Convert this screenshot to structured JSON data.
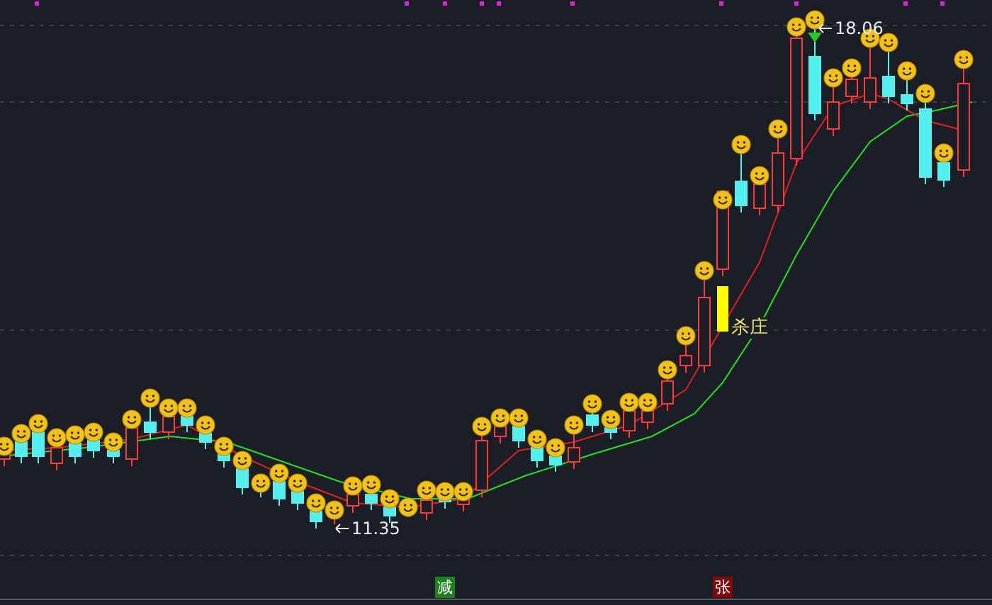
{
  "price_labels": [
    {
      "kind": "high",
      "text": "18.06"
    },
    {
      "kind": "low",
      "text": "11.35"
    }
  ],
  "signal_label": {
    "text": "杀庄"
  },
  "badges": [
    {
      "text": "减",
      "color": "#1e7f1e"
    },
    {
      "text": "张",
      "color": "#7d0b0b"
    }
  ]
}
